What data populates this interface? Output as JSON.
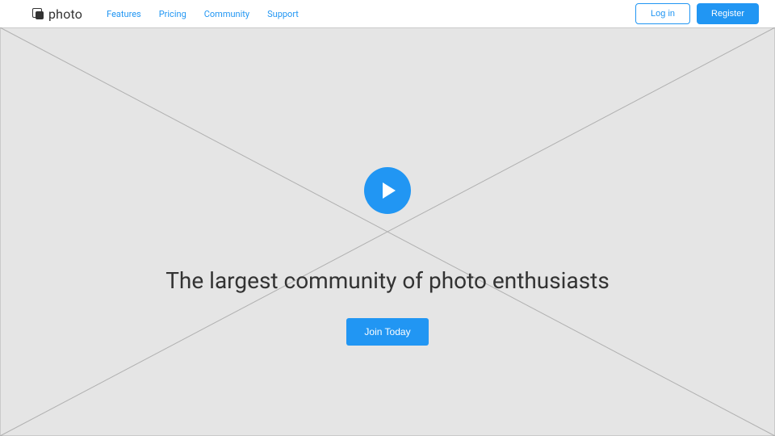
{
  "brand": {
    "name": "photo"
  },
  "nav": {
    "items": [
      {
        "label": "Features"
      },
      {
        "label": "Pricing"
      },
      {
        "label": "Community"
      },
      {
        "label": "Support"
      }
    ]
  },
  "auth": {
    "login_label": "Log in",
    "register_label": "Register"
  },
  "hero": {
    "title": "The largest community of photo enthusiasts",
    "cta_label": "Join Today"
  },
  "colors": {
    "accent": "#2196F3",
    "placeholder_bg": "#e5e5e5"
  }
}
